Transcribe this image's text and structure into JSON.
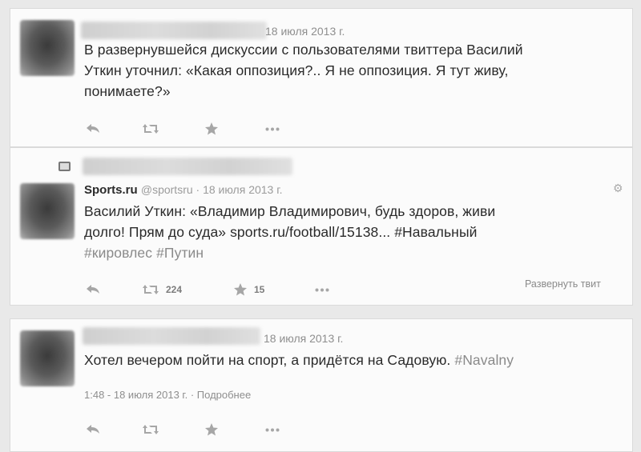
{
  "tweets": [
    {
      "date": "18 июля 2013 г.",
      "text_lines": [
        "В развернувшейся дискуссии с пользователями твиттера Василий",
        "Уткин уточнил: «Какая оппозиция?.. Я не оппозиция. Я тут живу,",
        "понимаете?»"
      ]
    },
    {
      "author": "Sports.ru",
      "handle": "@sportsru · 18 июля 2013 г.",
      "text_lines": [
        "Василий Уткин: «Владимир Владимирович, будь здоров, живи",
        "долго! Прям до суда» sports.ru/football/15138... #Навальный",
        "#кировлес #Путин"
      ],
      "retweets": "224",
      "favorites": "15",
      "expand_label": "Развернуть твит"
    },
    {
      "date": "18 июля 2013 г.",
      "text_plain": "Хотел вечером пойти на спорт, а придётся на Садовую.",
      "hashtag": "#Navalny",
      "meta_time": "1:48 - 18 июля 2013 г.",
      "meta_sep": "·",
      "meta_link": "Подробнее"
    }
  ],
  "icons": {
    "reply": "reply-icon",
    "retweet": "retweet-icon",
    "favorite": "star-icon",
    "more": "more-icon",
    "settings": "gear-icon",
    "retweeted": "retweeted-badge-icon"
  },
  "colors": {
    "background": "#e9e9e9",
    "card": "#fbfbfb",
    "muted": "#8e8e8e"
  }
}
